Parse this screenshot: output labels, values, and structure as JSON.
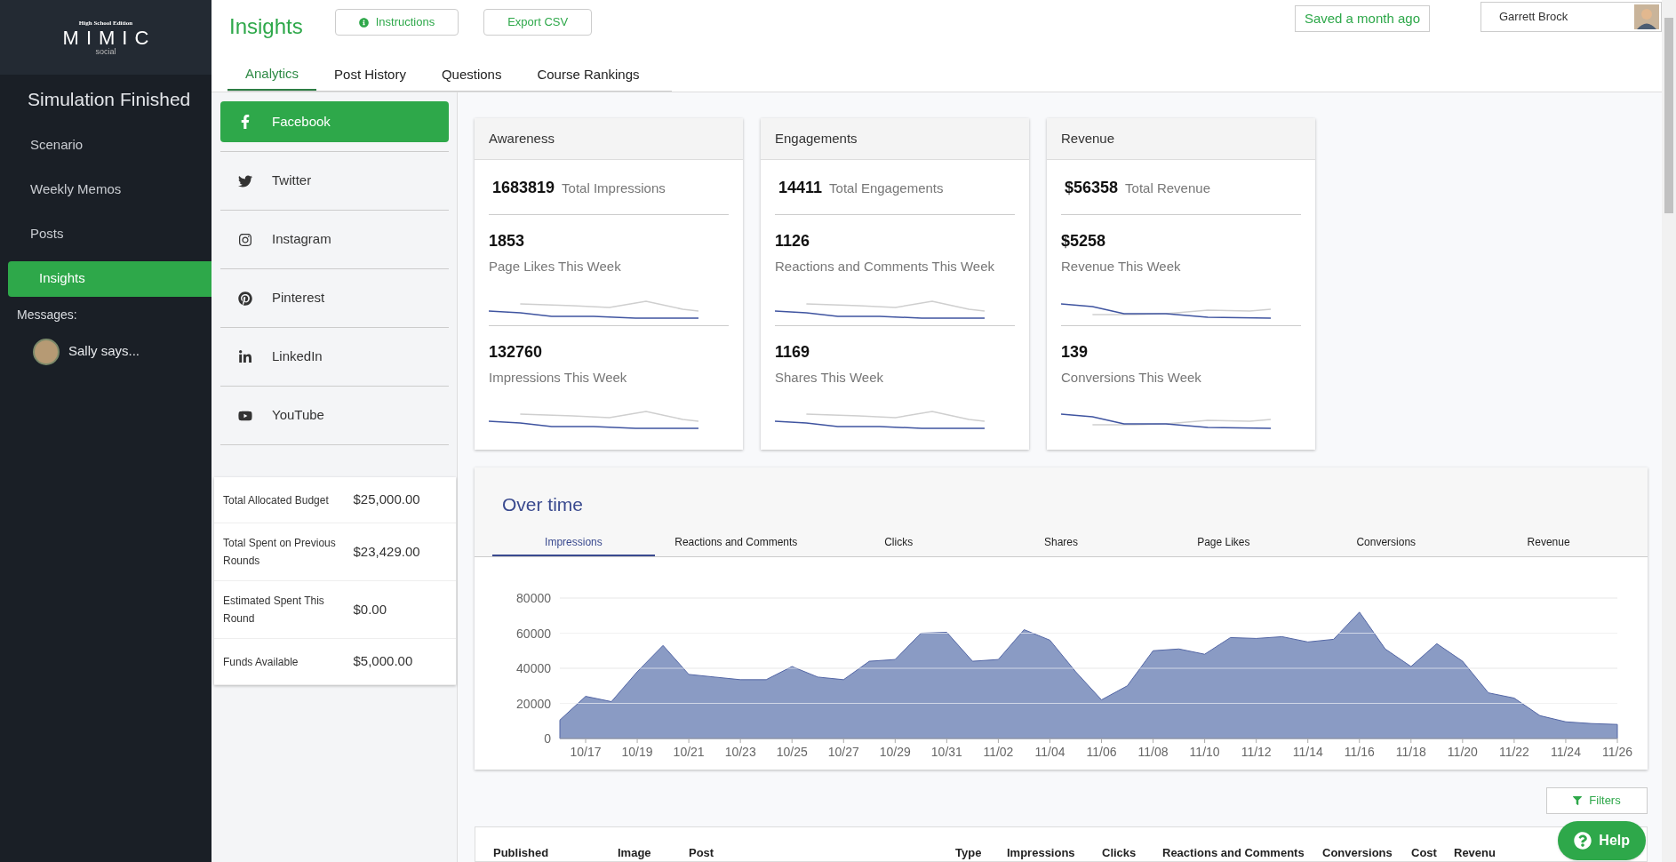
{
  "sidebar": {
    "logo": {
      "edition": "High School Edition",
      "name": "MIMIC",
      "tagline": "social"
    },
    "status": "Simulation Finished",
    "items": [
      {
        "label": "Scenario",
        "selected": false
      },
      {
        "label": "Weekly Memos",
        "selected": false
      },
      {
        "label": "Posts",
        "selected": false
      },
      {
        "label": "Insights",
        "selected": true
      }
    ],
    "messages_label": "Messages:",
    "messages": [
      {
        "label": "Sally says..."
      }
    ]
  },
  "header": {
    "title": "Insights",
    "buttons": [
      {
        "label": "Instructions",
        "kind": "info"
      },
      {
        "label": "Export CSV",
        "kind": "plain"
      }
    ],
    "save_status": "Saved a month ago",
    "user": "Garrett Brock"
  },
  "tabs": [
    {
      "label": "Analytics",
      "selected": true
    },
    {
      "label": "Post History",
      "selected": false
    },
    {
      "label": "Questions",
      "selected": false
    },
    {
      "label": "Course Rankings",
      "selected": false
    }
  ],
  "platforms": [
    {
      "label": "Facebook",
      "kind": "facebook",
      "selected": true
    },
    {
      "label": "Twitter",
      "kind": "twitter",
      "selected": false
    },
    {
      "label": "Instagram",
      "kind": "instagram",
      "selected": false
    },
    {
      "label": "Pinterest",
      "kind": "pinterest",
      "selected": false
    },
    {
      "label": "LinkedIn",
      "kind": "linkedin",
      "selected": false
    },
    {
      "label": "YouTube",
      "kind": "youtube",
      "selected": false
    }
  ],
  "budget": [
    {
      "label": "Total Allocated Budget",
      "value": "$25,000.00"
    },
    {
      "label": "Total Spent on Previous Rounds",
      "value": "$23,429.00"
    },
    {
      "label": "Estimated Spent This Round",
      "value": "$0.00"
    },
    {
      "label": "Funds Available",
      "value": "$5,000.00"
    }
  ],
  "cards": [
    {
      "title": "Awareness",
      "total": "1683819",
      "total_label": "Total Impressions",
      "metrics": [
        {
          "value": "1853",
          "label": "Page Likes This Week"
        },
        {
          "value": "132760",
          "label": "Impressions This Week"
        }
      ]
    },
    {
      "title": "Engagements",
      "total": "14411",
      "total_label": "Total Engagements",
      "metrics": [
        {
          "value": "1126",
          "label": "Reactions and Comments This Week"
        },
        {
          "value": "1169",
          "label": "Shares This Week"
        }
      ]
    },
    {
      "title": "Revenue",
      "total": "$56358",
      "total_label": "Total Revenue",
      "metrics": [
        {
          "value": "$5258",
          "label": "Revenue This Week"
        },
        {
          "value": "139",
          "label": "Conversions This Week"
        }
      ]
    }
  ],
  "over_time": {
    "title": "Over time",
    "tabs": [
      {
        "label": "Impressions",
        "selected": true
      },
      {
        "label": "Reactions and Comments",
        "selected": false
      },
      {
        "label": "Clicks",
        "selected": false
      },
      {
        "label": "Shares",
        "selected": false
      },
      {
        "label": "Page Likes",
        "selected": false
      },
      {
        "label": "Conversions",
        "selected": false
      },
      {
        "label": "Revenue",
        "selected": false
      }
    ],
    "chart_data": {
      "type": "area",
      "categories": [
        null,
        "10/17",
        null,
        "10/19",
        null,
        "10/21",
        null,
        "10/23",
        null,
        "10/25",
        null,
        "10/27",
        null,
        "10/29",
        null,
        "10/31",
        null,
        "11/02",
        null,
        "11/04",
        null,
        "11/06",
        null,
        "11/08",
        null,
        "11/10",
        null,
        "11/12",
        null,
        "11/14",
        null,
        "11/16",
        null,
        "11/18",
        null,
        "11/20",
        null,
        "11/22",
        null,
        "11/24",
        null,
        "11/26"
      ],
      "series": [
        {
          "color": "#8a9bc4",
          "values": [
            10500,
            24000,
            21000,
            38000,
            53000,
            36500,
            35000,
            33500,
            33500,
            41000,
            35000,
            33500,
            44000,
            45000,
            60000,
            60500,
            44000,
            45000,
            62000,
            56000,
            38000,
            22000,
            30000,
            50000,
            51000,
            48000,
            57500,
            57000,
            58000,
            55000,
            56500,
            72000,
            51000,
            41000,
            54000,
            44000,
            26000,
            23000,
            13000,
            9500,
            8500,
            8000
          ]
        }
      ],
      "ylim": [
        0,
        80000
      ],
      "yticks": [
        0,
        20000,
        40000,
        60000,
        80000
      ],
      "grid": true
    }
  },
  "filters_button": "Filters",
  "table": {
    "columns": [
      "Published",
      "Image",
      "Post",
      "Type",
      "Impressions",
      "Clicks",
      "Reactions and Comments",
      "Conversions",
      "Cost",
      "Revenu"
    ]
  },
  "help_button": "Help"
}
